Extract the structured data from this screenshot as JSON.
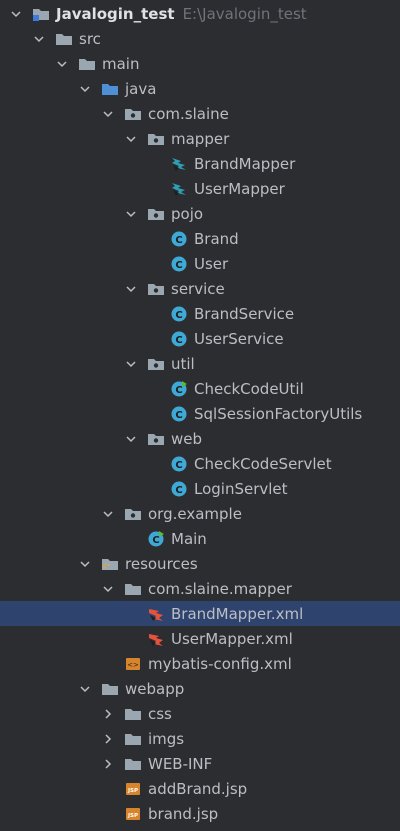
{
  "project": {
    "name": "Javalogin_test",
    "path": "E:\\Javalogin_test"
  },
  "colors": {
    "background": "#2b2d30",
    "selection": "#2e436e",
    "folder": "#9aa7b0",
    "class_icon": "#3fa9d5",
    "xml": "#e5533b",
    "jsp": "#d8842c"
  },
  "tree": [
    {
      "label": "Javalogin_test",
      "hint": "E:\\Javalogin_test",
      "level": 0,
      "toggle": "expanded",
      "icon": "module-folder",
      "bold": true
    },
    {
      "label": "src",
      "level": 1,
      "toggle": "expanded",
      "icon": "folder"
    },
    {
      "label": "main",
      "level": 2,
      "toggle": "expanded",
      "icon": "folder"
    },
    {
      "label": "java",
      "level": 3,
      "toggle": "expanded",
      "icon": "source-folder"
    },
    {
      "label": "com.slaine",
      "level": 4,
      "toggle": "expanded",
      "icon": "package"
    },
    {
      "label": "mapper",
      "level": 5,
      "toggle": "expanded",
      "icon": "package"
    },
    {
      "label": "BrandMapper",
      "level": 6,
      "toggle": "none",
      "icon": "mapper-interface"
    },
    {
      "label": "UserMapper",
      "level": 6,
      "toggle": "none",
      "icon": "mapper-interface"
    },
    {
      "label": "pojo",
      "level": 5,
      "toggle": "expanded",
      "icon": "package"
    },
    {
      "label": "Brand",
      "level": 6,
      "toggle": "none",
      "icon": "class"
    },
    {
      "label": "User",
      "level": 6,
      "toggle": "none",
      "icon": "class"
    },
    {
      "label": "service",
      "level": 5,
      "toggle": "expanded",
      "icon": "package"
    },
    {
      "label": "BrandService",
      "level": 6,
      "toggle": "none",
      "icon": "class"
    },
    {
      "label": "UserService",
      "level": 6,
      "toggle": "none",
      "icon": "class"
    },
    {
      "label": "util",
      "level": 5,
      "toggle": "expanded",
      "icon": "package"
    },
    {
      "label": "CheckCodeUtil",
      "level": 6,
      "toggle": "none",
      "icon": "class-runnable"
    },
    {
      "label": "SqlSessionFactoryUtils",
      "level": 6,
      "toggle": "none",
      "icon": "class"
    },
    {
      "label": "web",
      "level": 5,
      "toggle": "expanded",
      "icon": "package"
    },
    {
      "label": "CheckCodeServlet",
      "level": 6,
      "toggle": "none",
      "icon": "class"
    },
    {
      "label": "LoginServlet",
      "level": 6,
      "toggle": "none",
      "icon": "class"
    },
    {
      "label": "org.example",
      "level": 4,
      "toggle": "expanded",
      "icon": "package"
    },
    {
      "label": "Main",
      "level": 5,
      "toggle": "none",
      "icon": "class-runnable"
    },
    {
      "label": "resources",
      "level": 3,
      "toggle": "expanded",
      "icon": "resources-folder"
    },
    {
      "label": "com.slaine.mapper",
      "level": 4,
      "toggle": "expanded",
      "icon": "folder"
    },
    {
      "label": "BrandMapper.xml",
      "level": 5,
      "toggle": "none",
      "icon": "mybatis-xml",
      "selected": true
    },
    {
      "label": "UserMapper.xml",
      "level": 5,
      "toggle": "none",
      "icon": "mybatis-xml"
    },
    {
      "label": "mybatis-config.xml",
      "level": 4,
      "toggle": "none",
      "icon": "xml"
    },
    {
      "label": "webapp",
      "level": 3,
      "toggle": "expanded",
      "icon": "folder"
    },
    {
      "label": "css",
      "level": 4,
      "toggle": "collapsed",
      "icon": "folder"
    },
    {
      "label": "imgs",
      "level": 4,
      "toggle": "collapsed",
      "icon": "folder"
    },
    {
      "label": "WEB-INF",
      "level": 4,
      "toggle": "collapsed",
      "icon": "folder"
    },
    {
      "label": "addBrand.jsp",
      "level": 4,
      "toggle": "none",
      "icon": "jsp"
    },
    {
      "label": "brand.jsp",
      "level": 4,
      "toggle": "none",
      "icon": "jsp"
    }
  ]
}
